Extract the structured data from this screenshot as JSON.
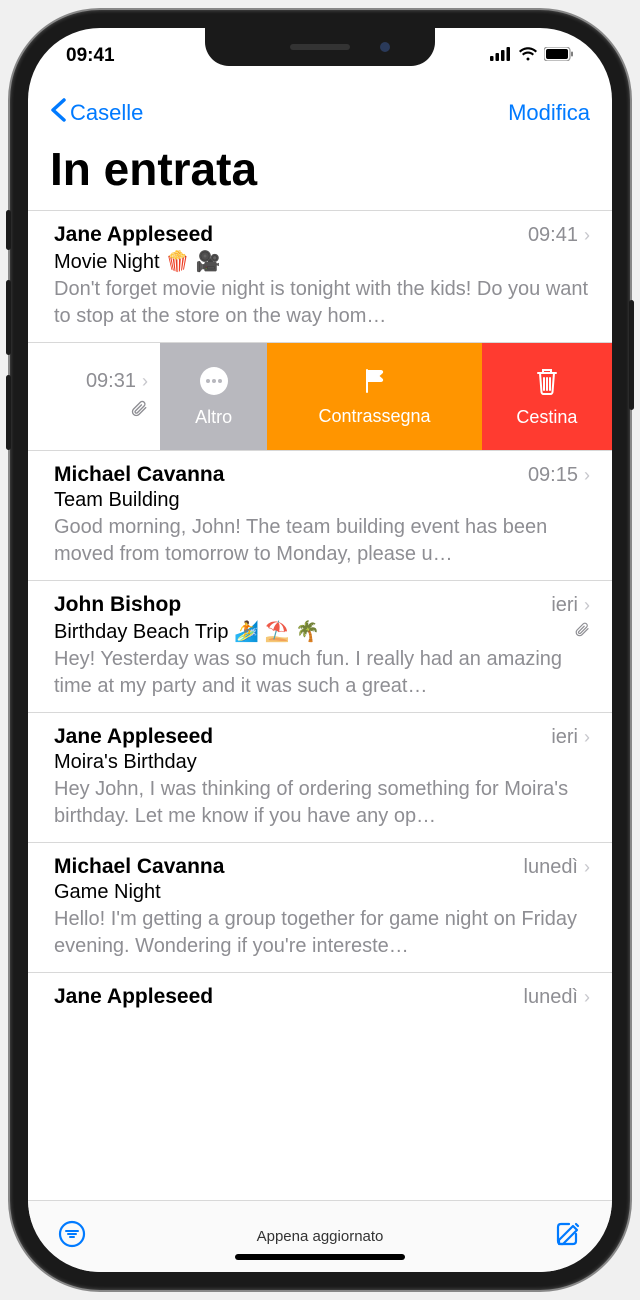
{
  "status": {
    "time": "09:41"
  },
  "nav": {
    "back": "Caselle",
    "edit": "Modifica"
  },
  "title": "In entrata",
  "swipe": {
    "time": "09:31",
    "more": "Altro",
    "flag": "Contrassegna",
    "trash": "Cestina"
  },
  "emails": [
    {
      "sender": "Jane Appleseed",
      "time": "09:41",
      "subject": "Movie Night 🍿 🎥",
      "preview": "Don't forget movie night is tonight with the kids! Do you want to stop at the store on the way hom…"
    },
    {
      "sender": "Michael Cavanna",
      "time": "09:15",
      "subject": "Team Building",
      "preview": "Good morning, John! The team building event has been moved from tomorrow to Monday, please u…"
    },
    {
      "sender": "John Bishop",
      "time": "ieri",
      "subject": "Birthday Beach Trip 🏄 ⛱️ 🌴",
      "preview": "Hey! Yesterday was so much fun. I really had an amazing time at my party and it was such a great…",
      "attachment": true
    },
    {
      "sender": "Jane Appleseed",
      "time": "ieri",
      "subject": "Moira's Birthday",
      "preview": "Hey John, I was thinking of ordering something for Moira's birthday. Let me know if you have any op…"
    },
    {
      "sender": "Michael Cavanna",
      "time": "lunedì",
      "subject": "Game Night",
      "preview": "Hello! I'm getting a group together for game night on Friday evening. Wondering if you're intereste…"
    },
    {
      "sender": "Jane Appleseed",
      "time": "lunedì",
      "subject": "",
      "preview": ""
    }
  ],
  "toolbar": {
    "status": "Appena aggiornato"
  }
}
